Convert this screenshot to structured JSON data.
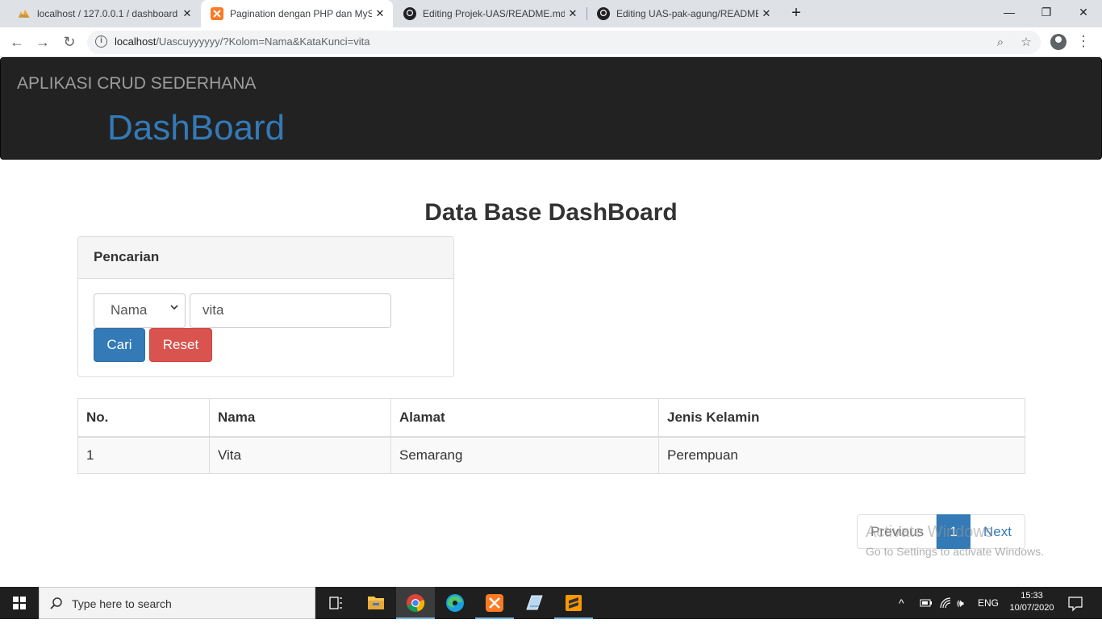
{
  "browser": {
    "tabs": [
      {
        "title": "localhost / 127.0.0.1 / dashboard",
        "icon": "phpmyadmin-icon"
      },
      {
        "title": "Pagination dengan PHP dan MySQL",
        "icon": "xampp-icon"
      },
      {
        "title": "Editing Projek-UAS/README.md",
        "icon": "github-icon"
      },
      {
        "title": "Editing UAS-pak-agung/README.md",
        "icon": "github-icon"
      }
    ],
    "new_tab": "+",
    "url_host": "localhost",
    "url_path": "/Uascuyyyyyy/?Kolom=Nama&KataKunci=vita"
  },
  "page": {
    "brand": "APLIKASI CRUD SEDERHANA",
    "heading": "DashBoard",
    "main_title": "Data Base DashBoard",
    "search_panel": {
      "title": "Pencarian",
      "select_value": "Nama",
      "input_value": "vita",
      "cari_label": "Cari",
      "reset_label": "Reset"
    },
    "table": {
      "headers": [
        "No.",
        "Nama",
        "Alamat",
        "Jenis Kelamin"
      ],
      "rows": [
        [
          "1",
          "Vita",
          "Semarang",
          "Perempuan"
        ]
      ]
    },
    "pagination": {
      "previous": "Previous",
      "current": "1",
      "next": "Next"
    },
    "watermark": {
      "line1": "Activate Windows",
      "line2": "Go to Settings to activate Windows."
    }
  },
  "taskbar": {
    "search_placeholder": "Type here to search",
    "language": "ENG",
    "time": "15:33",
    "date": "10/07/2020"
  },
  "colors": {
    "primary": "#337ab7",
    "danger": "#d9534f",
    "header_bg": "#222222"
  }
}
